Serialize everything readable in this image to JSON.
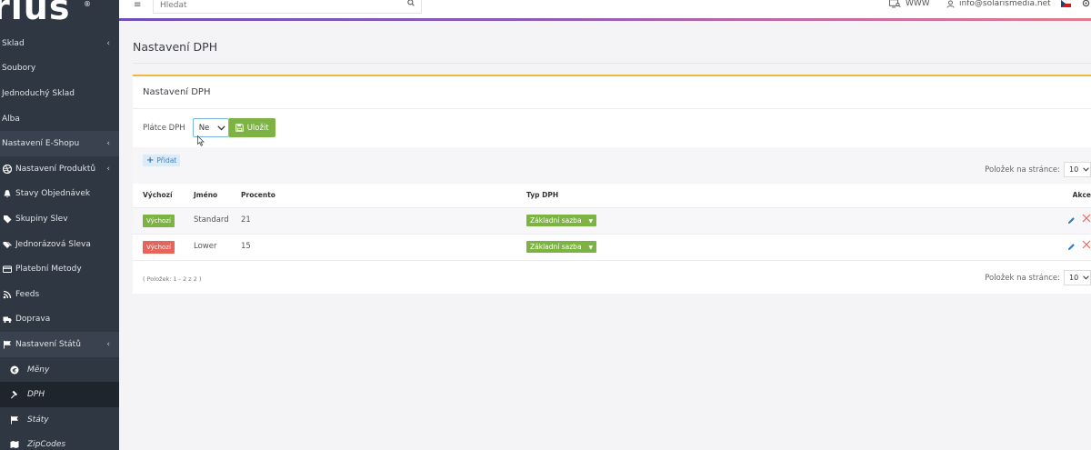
{
  "sidebar": {
    "logo": "rius",
    "logo_mark": "®",
    "items": [
      {
        "label": "Sklad",
        "chevron": "‹"
      },
      {
        "label": "Soubory"
      },
      {
        "label": "Jednoduchý Sklad"
      },
      {
        "label": "Alba"
      },
      {
        "label": "Nastavení E-Shopu",
        "chevron": "‹"
      },
      {
        "label": "Nastavení Produktů",
        "chevron": "‹",
        "icon": "dribbble-icon"
      },
      {
        "label": "Stavy Objednávek",
        "icon": "bell-icon"
      },
      {
        "label": "Skupiny Slev",
        "icon": "tag-icon"
      },
      {
        "label": "Jednorázová Sleva",
        "icon": "tags-icon"
      },
      {
        "label": "Platební Metody",
        "icon": "credit-card-icon"
      },
      {
        "label": "Feeds",
        "icon": "rss-icon"
      },
      {
        "label": "Doprava",
        "icon": "truck-icon"
      },
      {
        "label": "Nastavení Států",
        "chevron": "‹",
        "icon": "flag-icon"
      },
      {
        "label": "Měny",
        "icon": "euro-icon"
      },
      {
        "label": "DPH",
        "icon": "gavel-icon"
      },
      {
        "label": "Státy",
        "icon": "flag-icon"
      },
      {
        "label": "ZipCodes",
        "icon": "map-icon"
      }
    ]
  },
  "topbar": {
    "menu_icon": "≡",
    "search_placeholder": "Hledat",
    "search_icon": "⚲",
    "www": "WWW",
    "user_email": "info@solarismedia.net"
  },
  "page": {
    "title": "Nastavení DPH"
  },
  "card": {
    "title": "Nastavení DPH",
    "payer_label": "Plátce DPH",
    "payer_value": "Ne",
    "save_label": "Uložit",
    "add_label": "Přidat",
    "per_page_label": "Položek na stránce:",
    "per_page_value": "10",
    "columns": {
      "default": "Výchozí",
      "name": "Jméno",
      "percent": "Procento",
      "type": "Typ DPH",
      "actions": "Akce"
    },
    "rows": [
      {
        "default": "Výchozí",
        "default_color": "#7cb342",
        "name": "Standard",
        "percent": "21",
        "type": "Základní sazba"
      },
      {
        "default": "Výchozí",
        "default_color": "#e8645a",
        "name": "Lower",
        "percent": "15",
        "type": "Základní sazba"
      }
    ],
    "footer_info": "( Položek: 1 - 2 z 2 )"
  },
  "colors": {
    "sidebar_bg": "#2f3742",
    "accent_orange": "#f0b73f",
    "green": "#7cb342",
    "red": "#e8645a",
    "blue": "#2f7bc2"
  }
}
